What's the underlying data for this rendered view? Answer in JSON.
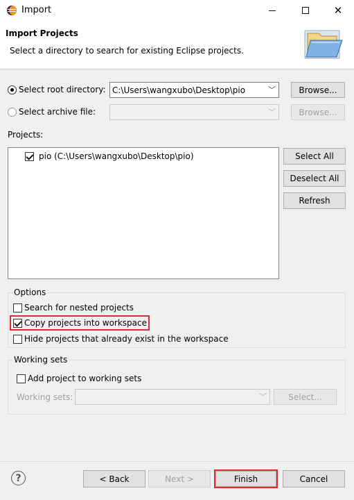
{
  "window": {
    "title": "Import"
  },
  "header": {
    "title": "Import Projects",
    "description": "Select a directory to search for existing Eclipse projects."
  },
  "source": {
    "root_directory_label": "Select root directory:",
    "root_directory_value": "C:\\Users\\wangxubo\\Desktop\\pio",
    "root_browse_label": "Browse...",
    "archive_file_label": "Select archive file:",
    "archive_file_value": "",
    "archive_browse_label": "Browse...",
    "selected": "root_directory"
  },
  "projects": {
    "label": "Projects:",
    "items": [
      {
        "label": "pio (C:\\Users\\wangxubo\\Desktop\\pio)",
        "checked": true
      }
    ],
    "select_all_label": "Select All",
    "deselect_all_label": "Deselect All",
    "refresh_label": "Refresh"
  },
  "options": {
    "title": "Options",
    "search_nested_label": "Search for nested projects",
    "search_nested_checked": false,
    "copy_into_workspace_label": "Copy projects into workspace",
    "copy_into_workspace_checked": true,
    "hide_existing_label": "Hide projects that already exist in the workspace",
    "hide_existing_checked": false
  },
  "working_sets": {
    "title": "Working sets",
    "add_label": "Add project to working sets",
    "add_checked": false,
    "working_sets_label": "Working sets:",
    "working_sets_value": "",
    "select_label": "Select..."
  },
  "footer": {
    "help_glyph": "?",
    "back_label": "< Back",
    "next_label": "Next >",
    "finish_label": "Finish",
    "cancel_label": "Cancel"
  },
  "annotation": {
    "highlight_color": "#e22b2b"
  }
}
